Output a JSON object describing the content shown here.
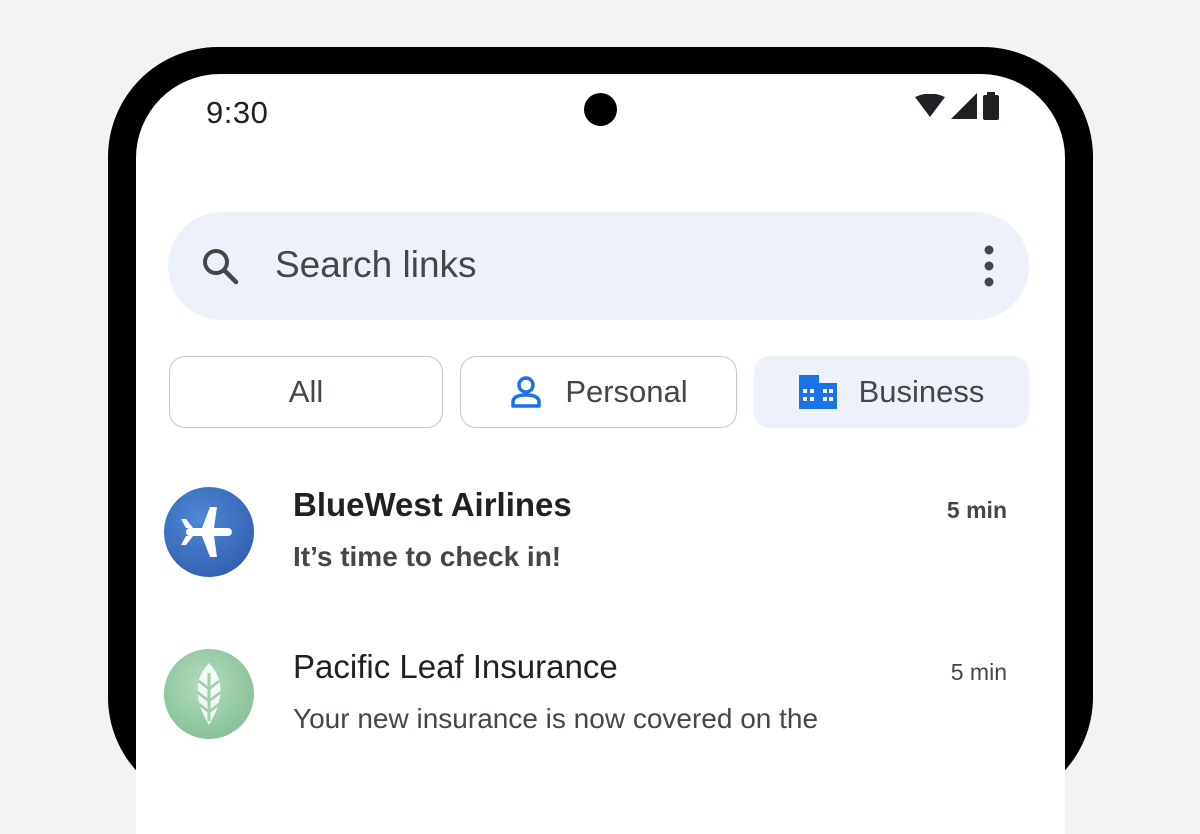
{
  "status_bar": {
    "time": "9:30",
    "icons": [
      "wifi-icon",
      "cellular-signal-icon",
      "battery-icon"
    ]
  },
  "search": {
    "placeholder": "Search links",
    "icon": "search-icon",
    "menu_icon": "more-vertical-icon"
  },
  "filters": [
    {
      "label": "All",
      "selected": false
    },
    {
      "label": "Personal",
      "icon": "person-icon",
      "selected": false
    },
    {
      "label": "Business",
      "icon": "business-building-icon",
      "selected": true
    }
  ],
  "conversations": [
    {
      "sender": "BlueWest Airlines",
      "snippet": "It’s time to check in!",
      "time": "5 min",
      "unread": true,
      "avatar_icon": "airplane-icon",
      "avatar_color": "#3f72c4"
    },
    {
      "sender": "Pacific Leaf Insurance",
      "snippet": "Your new insurance is now covered on the",
      "time": "5 min",
      "unread": false,
      "avatar_icon": "leaf-icon",
      "avatar_color": "#9ccfab"
    }
  ],
  "colors": {
    "accent": "#1a73e8",
    "search_bg": "#edf2fa",
    "selected_chip_bg": "#edf2fa",
    "text_primary": "#202124",
    "text_secondary": "#444746"
  }
}
